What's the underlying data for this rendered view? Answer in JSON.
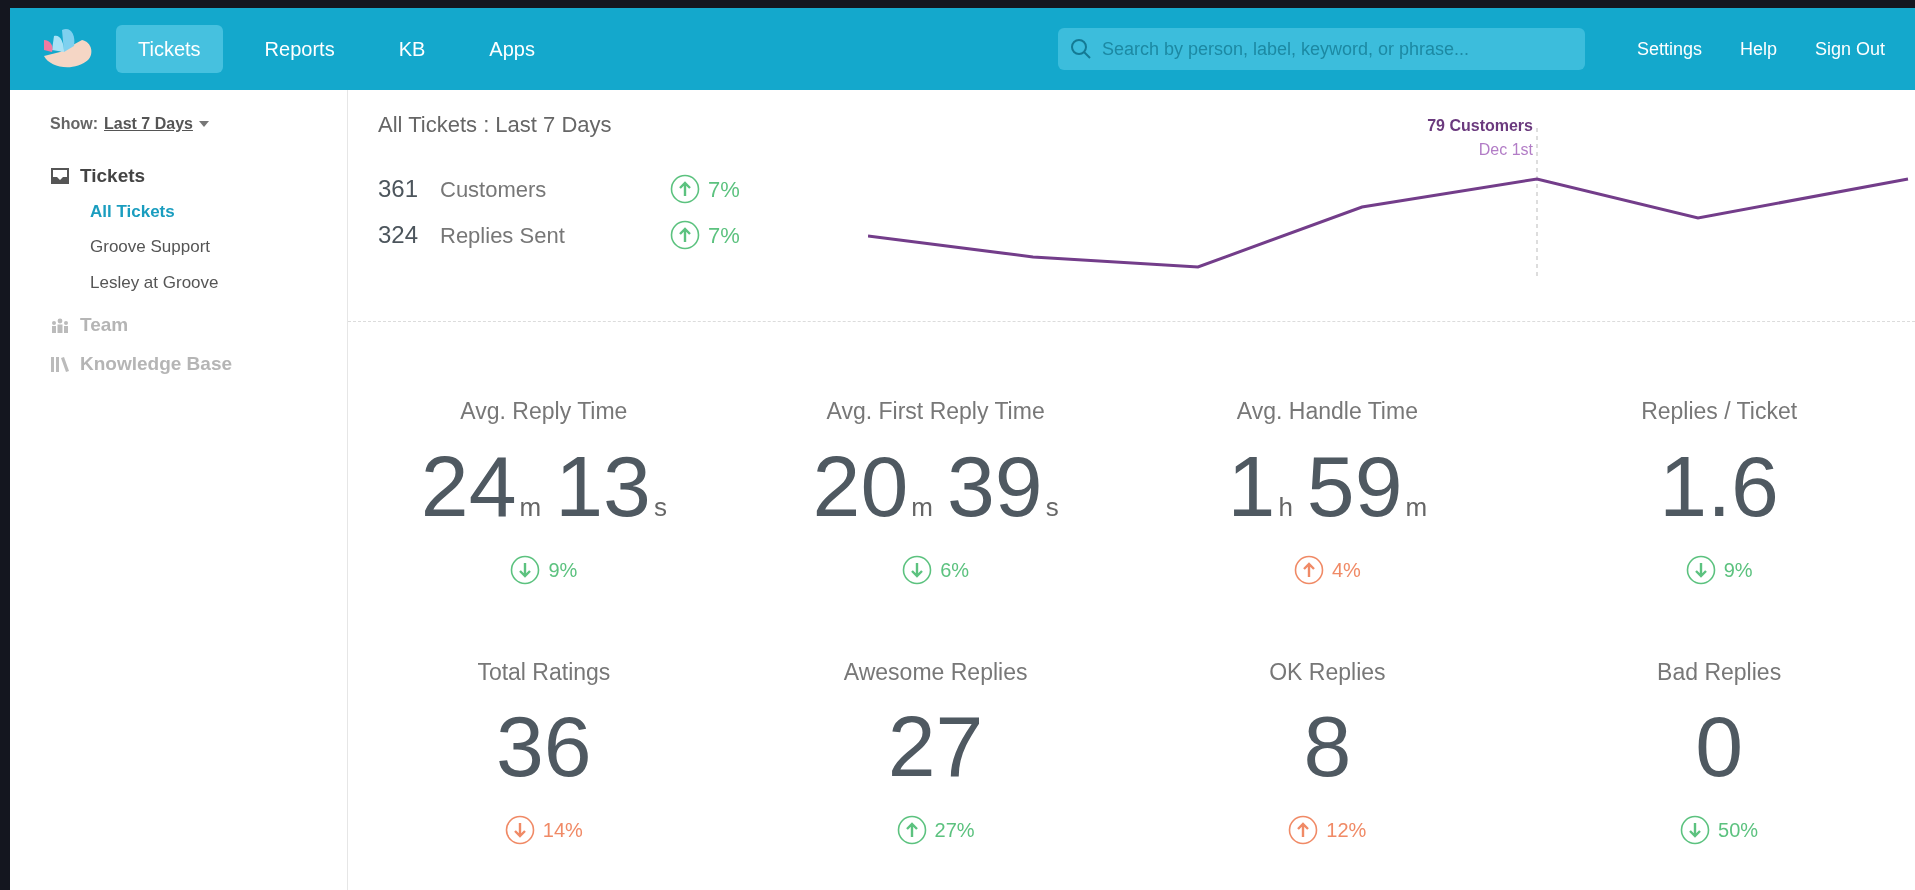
{
  "nav": {
    "tabs": [
      {
        "label": "Tickets",
        "selected": true
      },
      {
        "label": "Reports",
        "selected": false
      },
      {
        "label": "KB",
        "selected": false
      },
      {
        "label": "Apps",
        "selected": false
      }
    ],
    "search": {
      "placeholder": "Search by person, label, keyword, or phrase..."
    },
    "links": [
      "Settings",
      "Help",
      "Sign Out"
    ]
  },
  "sidebar": {
    "show_label": "Show:",
    "show_value": "Last 7 Days",
    "sections": [
      {
        "kind": "tickets",
        "label": "Tickets",
        "disabled": false,
        "items": [
          {
            "label": "All Tickets",
            "selected": true
          },
          {
            "label": "Groove Support",
            "selected": false
          },
          {
            "label": "Lesley at Groove",
            "selected": false
          }
        ]
      },
      {
        "kind": "team",
        "label": "Team",
        "disabled": true
      },
      {
        "kind": "kb",
        "label": "Knowledge Base",
        "disabled": true
      }
    ]
  },
  "title": "All Tickets : Last 7 Days",
  "summary": [
    {
      "value": "361",
      "label": "Customers",
      "kind": "up",
      "change": "7%",
      "color": "#5cc27f"
    },
    {
      "value": "324",
      "label": "Replies Sent",
      "kind": "up",
      "change": "7%",
      "color": "#5cc27f"
    }
  ],
  "chart_tooltip": {
    "title": "79 Customers",
    "subtitle": "Dec 1st"
  },
  "metrics": [
    {
      "label": "Avg. Reply Time",
      "parts": [
        {
          "number": "24",
          "unit": "m"
        },
        {
          "number": "13",
          "unit": "s"
        }
      ],
      "kind": "down",
      "change": "9%",
      "color": "#5cc27f"
    },
    {
      "label": "Avg. First Reply Time",
      "parts": [
        {
          "number": "20",
          "unit": "m"
        },
        {
          "number": "39",
          "unit": "s"
        }
      ],
      "kind": "down",
      "change": "6%",
      "color": "#5cc27f"
    },
    {
      "label": "Avg. Handle Time",
      "parts": [
        {
          "number": "1",
          "unit": "h"
        },
        {
          "number": "59",
          "unit": "m"
        }
      ],
      "kind": "up",
      "change": "4%",
      "color": "#f08a66"
    },
    {
      "label": "Replies / Ticket",
      "parts": [
        {
          "number": "1.6"
        }
      ],
      "kind": "down",
      "change": "9%",
      "color": "#5cc27f"
    },
    {
      "label": "Total Ratings",
      "parts": [
        {
          "number": "36"
        }
      ],
      "kind": "down",
      "change": "14%",
      "color": "#f08a66"
    },
    {
      "label": "Awesome Replies",
      "parts": [
        {
          "number": "27"
        }
      ],
      "kind": "up",
      "change": "27%",
      "color": "#5cc27f"
    },
    {
      "label": "OK Replies",
      "parts": [
        {
          "number": "8"
        }
      ],
      "kind": "up",
      "change": "12%",
      "color": "#f08a66"
    },
    {
      "label": "Bad Replies",
      "parts": [
        {
          "number": "0"
        }
      ],
      "kind": "down",
      "change": "50%",
      "color": "#5cc27f"
    }
  ]
}
